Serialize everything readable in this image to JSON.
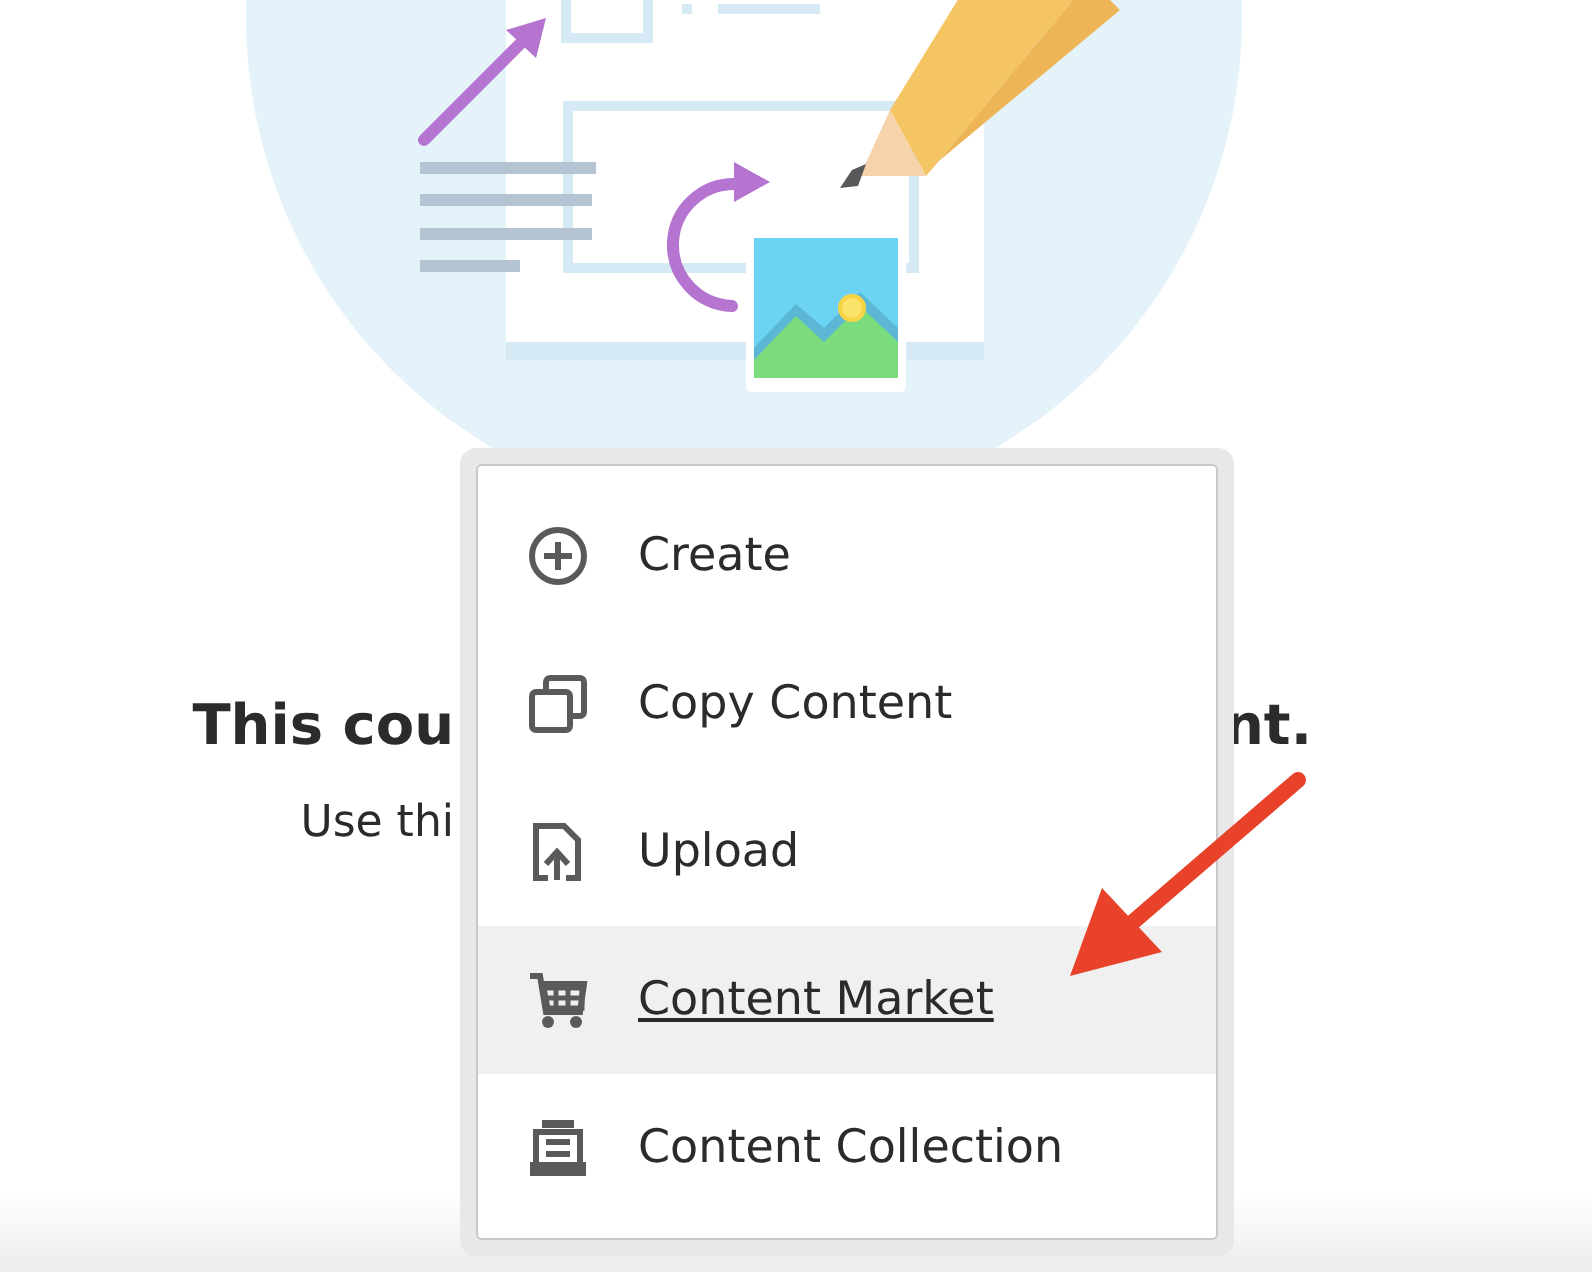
{
  "heading": {
    "left": "This cou",
    "right": "nt."
  },
  "subtext": "Use thi",
  "menu": [
    {
      "label": "Create",
      "kind": "create",
      "selected": false
    },
    {
      "label": "Copy Content",
      "kind": "copy",
      "selected": false
    },
    {
      "label": "Upload",
      "kind": "upload",
      "selected": false
    },
    {
      "label": "Content Market",
      "kind": "cart",
      "selected": true
    },
    {
      "label": "Content Collection",
      "kind": "collection",
      "selected": false
    }
  ]
}
